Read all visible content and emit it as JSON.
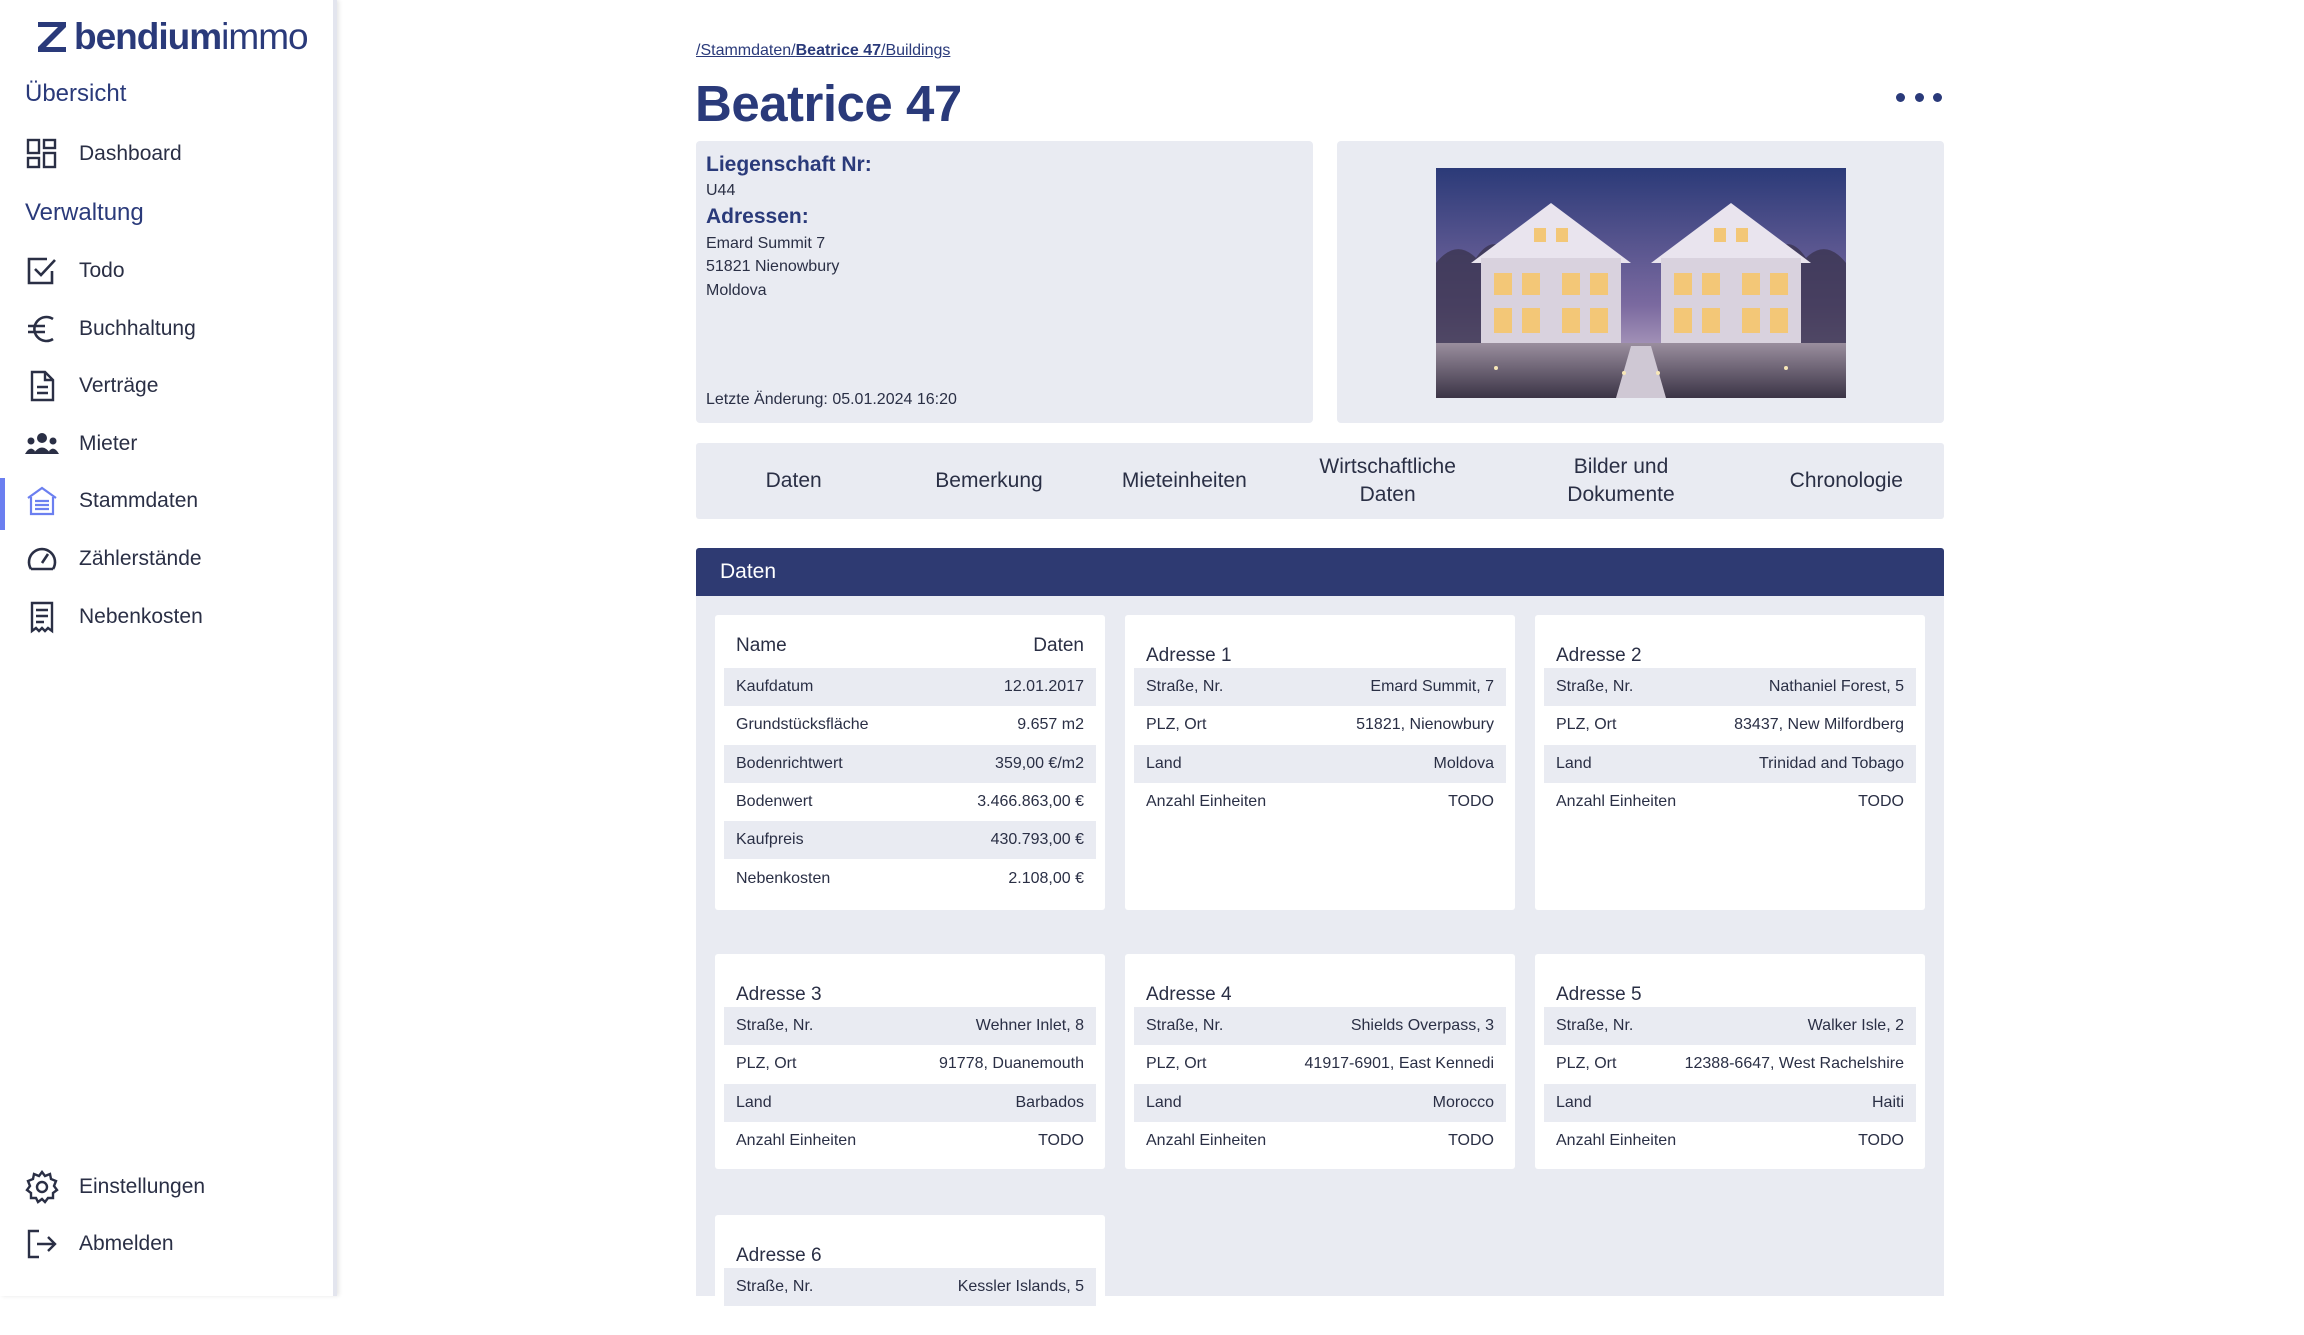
{
  "brand": {
    "name_bold": "bendium",
    "name_light": "immo"
  },
  "sidebar": {
    "section_overview": "Übersicht",
    "section_admin": "Verwaltung",
    "items": [
      {
        "label": "Dashboard",
        "icon": "dashboard-icon"
      },
      {
        "label": "Todo",
        "icon": "checkbox-icon"
      },
      {
        "label": "Buchhaltung",
        "icon": "euro-icon"
      },
      {
        "label": "Verträge",
        "icon": "document-icon"
      },
      {
        "label": "Mieter",
        "icon": "people-icon"
      },
      {
        "label": "Stammdaten",
        "icon": "building-icon",
        "active": true
      },
      {
        "label": "Zählerstände",
        "icon": "gauge-icon"
      },
      {
        "label": "Nebenkosten",
        "icon": "receipt-icon"
      }
    ],
    "bottom": [
      {
        "label": "Einstellungen",
        "icon": "gear-icon"
      },
      {
        "label": "Abmelden",
        "icon": "logout-icon"
      }
    ]
  },
  "breadcrumb": {
    "part1": "/Stammdaten/",
    "part2": "Beatrice 47",
    "part3": "/Buildings"
  },
  "page_title": "Beatrice 47",
  "info": {
    "liegenschaft_label": "Liegenschaft Nr:",
    "liegenschaft_value": "U44",
    "adressen_label": "Adressen:",
    "address_lines": [
      "Emard Summit 7",
      "51821 Nienowbury",
      "Moldova"
    ],
    "last_change": "Letzte Änderung: 05.01.2024 16:20"
  },
  "tabs": [
    {
      "label": "Daten"
    },
    {
      "label": "Bemerkung"
    },
    {
      "label": "Mieteinheiten"
    },
    {
      "label": "Wirtschaftliche Daten"
    },
    {
      "label": "Bilder und Dokumente"
    },
    {
      "label": "Chronologie"
    }
  ],
  "section_title": "Daten",
  "data_card": {
    "col_name": "Name",
    "col_value": "Daten",
    "rows": [
      {
        "label": "Kaufdatum",
        "value": "12.01.2017"
      },
      {
        "label": "Grundstücksfläche",
        "value": "9.657 m2"
      },
      {
        "label": "Bodenrichtwert",
        "value": "359,00 €/m2"
      },
      {
        "label": "Bodenwert",
        "value": "3.466.863,00 €"
      },
      {
        "label": "Kaufpreis",
        "value": "430.793,00 €"
      },
      {
        "label": "Nebenkosten",
        "value": "2.108,00 €"
      }
    ]
  },
  "address_cards": [
    {
      "title": "Adresse 1",
      "rows": [
        {
          "label": "Straße, Nr.",
          "value": "Emard Summit, 7"
        },
        {
          "label": "PLZ, Ort",
          "value": "51821, Nienowbury"
        },
        {
          "label": "Land",
          "value": "Moldova"
        },
        {
          "label": "Anzahl Einheiten",
          "value": "TODO"
        }
      ]
    },
    {
      "title": "Adresse 2",
      "rows": [
        {
          "label": "Straße, Nr.",
          "value": "Nathaniel Forest, 5"
        },
        {
          "label": "PLZ, Ort",
          "value": "83437, New Milfordberg"
        },
        {
          "label": "Land",
          "value": "Trinidad and Tobago"
        },
        {
          "label": "Anzahl Einheiten",
          "value": "TODO"
        }
      ]
    },
    {
      "title": "Adresse 3",
      "rows": [
        {
          "label": "Straße, Nr.",
          "value": "Wehner Inlet, 8"
        },
        {
          "label": "PLZ, Ort",
          "value": "91778, Duanemouth"
        },
        {
          "label": "Land",
          "value": "Barbados"
        },
        {
          "label": "Anzahl Einheiten",
          "value": "TODO"
        }
      ]
    },
    {
      "title": "Adresse 4",
      "rows": [
        {
          "label": "Straße, Nr.",
          "value": "Shields Overpass, 3"
        },
        {
          "label": "PLZ, Ort",
          "value": "41917-6901, East Kennedi"
        },
        {
          "label": "Land",
          "value": "Morocco"
        },
        {
          "label": "Anzahl Einheiten",
          "value": "TODO"
        }
      ]
    },
    {
      "title": "Adresse 5",
      "rows": [
        {
          "label": "Straße, Nr.",
          "value": "Walker Isle, 2"
        },
        {
          "label": "PLZ, Ort",
          "value": "12388-6647, West Rachelshire"
        },
        {
          "label": "Land",
          "value": "Haiti"
        },
        {
          "label": "Anzahl Einheiten",
          "value": "TODO"
        }
      ]
    },
    {
      "title": "Adresse 6",
      "rows": [
        {
          "label": "Straße, Nr.",
          "value": "Kessler Islands, 5"
        }
      ]
    }
  ]
}
